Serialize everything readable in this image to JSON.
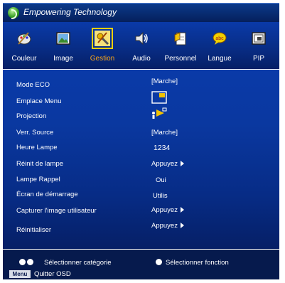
{
  "header": {
    "title": "Empowering Technology"
  },
  "tabs": [
    {
      "label": "Couleur",
      "icon": "paint-palette-icon"
    },
    {
      "label": "Image",
      "icon": "picture-icon"
    },
    {
      "label": "Gestion",
      "icon": "tools-icon",
      "active": true
    },
    {
      "label": "Audio",
      "icon": "speaker-icon"
    },
    {
      "label": "Personnel",
      "icon": "user-document-icon"
    },
    {
      "label": "Langue",
      "icon": "speech-bubble-icon"
    },
    {
      "label": "PIP",
      "icon": "pip-icon"
    }
  ],
  "settings": [
    {
      "label": "Mode ECO",
      "value": "[Marche]"
    },
    {
      "label": "Emplace Menu",
      "value_icon": "menu-position-icon"
    },
    {
      "label": "Projection",
      "value_icon": "projection-mode-icon"
    },
    {
      "label": "Verr. Source",
      "value": "[Marche]"
    },
    {
      "label": "Heure Lampe",
      "value": "1234"
    },
    {
      "label": "Réinit de lampe",
      "value": "Appuyez"
    },
    {
      "label": "Lampe Rappel",
      "value": "Oui"
    },
    {
      "label": "Écran de démarrage",
      "value": "Utilis"
    },
    {
      "label": "Capturer l'image utilisateur",
      "value": "Appuyez"
    },
    {
      "label": "Réinitialiser",
      "value": "Appuyez"
    }
  ],
  "footer": {
    "select_category": "Sélectionner catégorie",
    "select_function": "Sélectionner fonction",
    "menu_badge": "Menu",
    "quit": "Quitter OSD"
  },
  "colors": {
    "panel": "#0a38a0",
    "header": "#0b3a8a",
    "active_label": "#f5a31a",
    "highlight": "#f0d000"
  }
}
